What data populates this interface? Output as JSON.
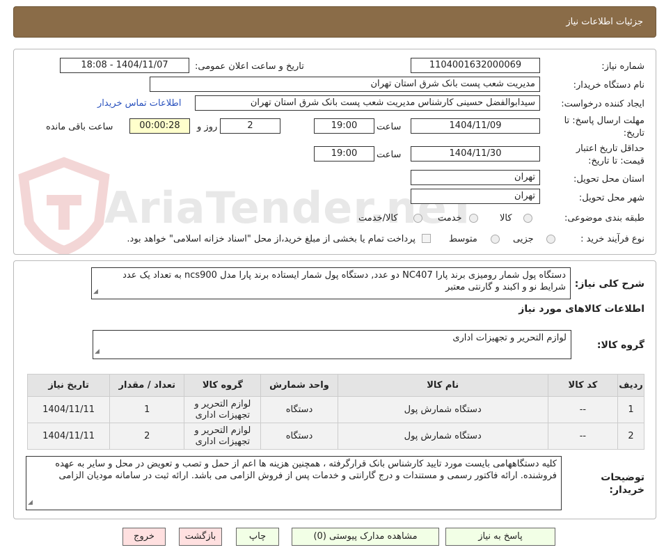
{
  "header": {
    "title": "جزئیات اطلاعات نیاز"
  },
  "watermark": {
    "text": "AriaTender.neT"
  },
  "fields": {
    "need_number_label": "شماره نیاز:",
    "need_number": "1104001632000069",
    "announce_label": "تاریخ و ساعت اعلان عمومی:",
    "announce_value": "1404/11/07 - 18:08",
    "buyer_label": "نام دستگاه خریدار:",
    "buyer_value": "مدیریت شعب پست بانک شرق استان تهران",
    "creator_label": "ایجاد کننده درخواست:",
    "creator_value": "سیدابوالفضل حسینی کارشناس مدیریت شعب پست بانک شرق استان تهران",
    "contact_link": "اطلاعات تماس خریدار",
    "deadline_label_1": "مهلت ارسال پاسخ: تا",
    "deadline_label_2": "تاریخ:",
    "deadline_date": "1404/11/09",
    "time_label": "ساعت",
    "deadline_time": "19:00",
    "days_value": "2",
    "days_label": "روز و",
    "remaining_value": "00:00:28",
    "remaining_label": "ساعت باقی مانده",
    "validity_label_1": "حداقل تاریخ اعتبار",
    "validity_label_2": "قیمت: تا تاریخ:",
    "validity_date": "1404/11/30",
    "validity_time": "19:00",
    "province_label": "استان محل تحویل:",
    "province_value": "تهران",
    "city_label": "شهر محل تحویل:",
    "city_value": "تهران",
    "category_label": "طبقه بندی موضوعی:",
    "category_options": [
      "کالا",
      "خدمت",
      "کالا/خدمت"
    ],
    "process_label": "نوع فرآیند خرید :",
    "process_options": [
      "جزیی",
      "متوسط"
    ],
    "payment_note": "پرداخت تمام یا بخشی از مبلغ خرید،از محل \"اسناد خزانه اسلامی\" خواهد بود."
  },
  "description": {
    "label": "شرح کلی نیاز:",
    "text": "دستگاه پول شمار رومیزی برند پارا NC407 دو عدد, دستگاه پول شمار ایستاده برند پارا مدل ncs900 به تعداد یک عدد شرایط نو و اکبند و گارنتی معتبر"
  },
  "goods": {
    "section_title": "اطلاعات کالاهای مورد نیاز",
    "group_label": "گروه کالا:",
    "group_value": "لوازم التحریر و تجهیزات اداری"
  },
  "table": {
    "headers": [
      "ردیف",
      "کد کالا",
      "نام کالا",
      "واحد شمارش",
      "گروه کالا",
      "تعداد / مقدار",
      "تاریخ نیاز"
    ],
    "rows": [
      [
        "1",
        "--",
        "دستگاه شمارش پول",
        "دستگاه",
        "لوازم التحریر و تجهیزات اداری",
        "1",
        "1404/11/11"
      ],
      [
        "2",
        "--",
        "دستگاه شمارش پول",
        "دستگاه",
        "لوازم التحریر و تجهیزات اداری",
        "2",
        "1404/11/11"
      ]
    ]
  },
  "buyer_notes": {
    "label_1": "توضیحات",
    "label_2": "خریدار:",
    "text": "کلیه دستگاههامی بایست مورد تایید کارشناس بانک قرارگرفته ، همچنین هزینه ها اعم از حمل و تصب و تعویض در محل و سایر به عهده فروشنده. ارائه فاکتور رسمی و مستندات و درج گارانتی و خدمات پس از فروش الزامی می باشد. ارائه ثبت در سامانه مودیان الزامی"
  },
  "buttons": {
    "reply": "پاسخ به نیاز",
    "attachments": "مشاهده مدارک پیوستی (0)",
    "print": "چاپ",
    "back": "بازگشت",
    "exit": "خروج"
  }
}
